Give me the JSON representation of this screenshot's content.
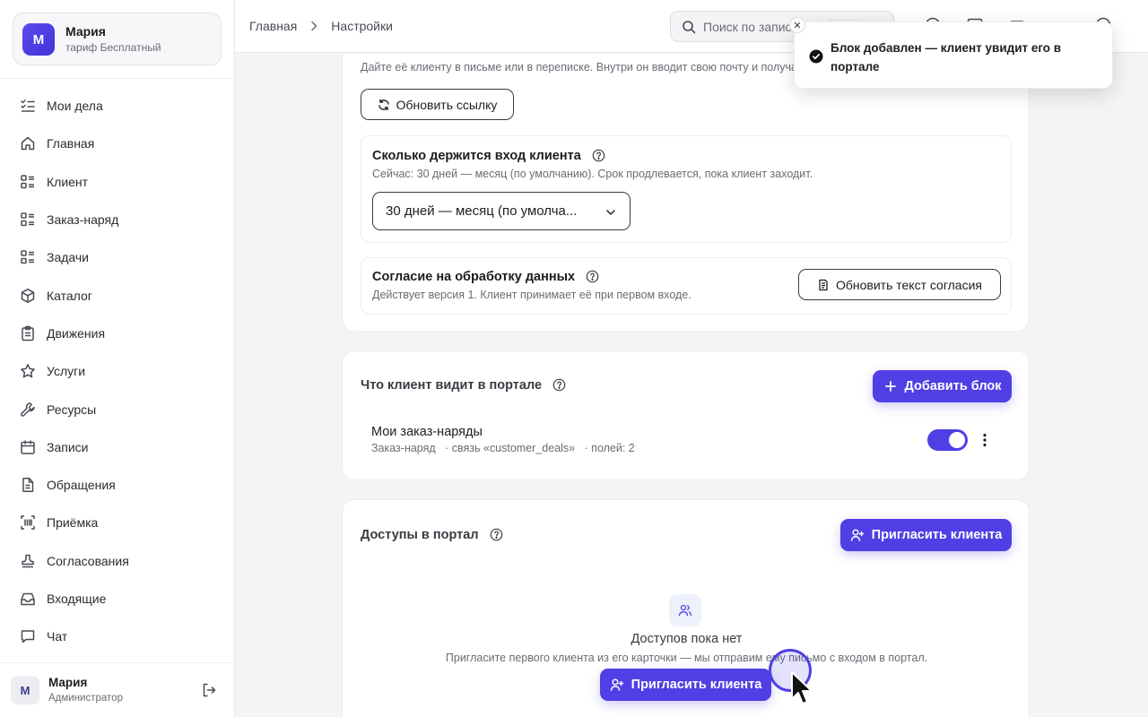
{
  "profile": {
    "initial": "М",
    "name": "Мария",
    "plan": "тариф Бесплатный"
  },
  "nav": [
    {
      "label": "Мои дела",
      "icon": "list-check-icon"
    },
    {
      "label": "Главная",
      "icon": "home-icon"
    },
    {
      "label": "Клиент",
      "icon": "grid-list-icon"
    },
    {
      "label": "Заказ-наряд",
      "icon": "grid-list-icon"
    },
    {
      "label": "Задачи",
      "icon": "grid-list-icon"
    },
    {
      "label": "Каталог",
      "icon": "box-icon"
    },
    {
      "label": "Движения",
      "icon": "clipboard-icon"
    },
    {
      "label": "Услуги",
      "icon": "star-icon"
    },
    {
      "label": "Ресурсы",
      "icon": "wrench-icon"
    },
    {
      "label": "Записи",
      "icon": "calendar-icon"
    },
    {
      "label": "Обращения",
      "icon": "document-icon"
    },
    {
      "label": "Приёмка",
      "icon": "scan-icon"
    },
    {
      "label": "Согласования",
      "icon": "stamp-icon"
    },
    {
      "label": "Входящие",
      "icon": "inbox-icon"
    },
    {
      "label": "Чат",
      "icon": "chat-icon"
    }
  ],
  "user": {
    "initial": "М",
    "name": "Мария",
    "role": "Администратор"
  },
  "breadcrumb": {
    "home": "Главная",
    "current": "Настройки"
  },
  "search": {
    "placeholder": "Поиск по записям"
  },
  "link_card": {
    "description": "Дайте её клиенту в письме или в переписке. Внутри он вводит свою почту и получает код",
    "refresh_button": "Обновить ссылку",
    "session": {
      "title": "Сколько держится вход клиента",
      "note": "Сейчас: 30 дней — месяц (по умолчанию). Срок продлевается, пока клиент заходит.",
      "selected": "30 дней — месяц (по умолча..."
    },
    "consent": {
      "title": "Согласие на обработку данных",
      "note": "Действует версия 1. Клиент принимает её при первом входе.",
      "button": "Обновить текст согласия"
    }
  },
  "portal_blocks": {
    "title": "Что клиент видит в портале",
    "add_button": "Добавить блок",
    "item": {
      "name": "Мои заказ-наряды",
      "entity": "Заказ-наряд",
      "relation": "· связь «customer_deals»",
      "fields": "· полей: 2",
      "enabled": true
    }
  },
  "access": {
    "title": "Доступы в портал",
    "invite_button": "Пригласить клиента",
    "empty_title": "Доступов пока нет",
    "empty_note": "Пригласите первого клиента из его карточки — мы отправим ему письмо с входом в портал.",
    "empty_button": "Пригласить клиента"
  },
  "toast": {
    "message": "Блок добавлен — клиент увидит его в портале"
  },
  "colors": {
    "accent": "#4f3fe4",
    "text": "#1d1d22",
    "muted": "#6b6b75"
  }
}
